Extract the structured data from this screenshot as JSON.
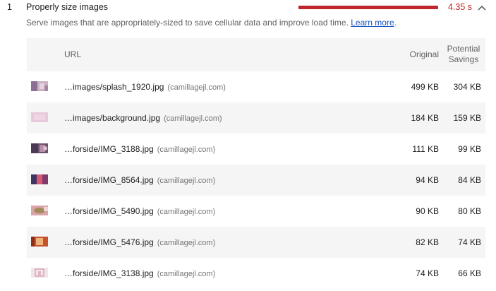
{
  "audit": {
    "index": "1",
    "title": "Properly size images",
    "savings": "4.35 s",
    "description": "Serve images that are appropriately-sized to save cellular data and improve load time.",
    "learn_more": "Learn more",
    "description_end": "."
  },
  "table": {
    "columns": {
      "url": "URL",
      "original": "Original",
      "savings_line1": "Potential",
      "savings_line2": "Savings"
    },
    "rows": [
      {
        "url": "…images/splash_1920.jpg",
        "host": "(camillagejl.com)",
        "original": "499 KB",
        "savings": "304 KB"
      },
      {
        "url": "…images/background.jpg",
        "host": "(camillagejl.com)",
        "original": "184 KB",
        "savings": "159 KB"
      },
      {
        "url": "…forside/IMG_3188.jpg",
        "host": "(camillagejl.com)",
        "original": "111 KB",
        "savings": "99 KB"
      },
      {
        "url": "…forside/IMG_8564.jpg",
        "host": "(camillagejl.com)",
        "original": "94 KB",
        "savings": "84 KB"
      },
      {
        "url": "…forside/IMG_5490.jpg",
        "host": "(camillagejl.com)",
        "original": "90 KB",
        "savings": "80 KB"
      },
      {
        "url": "…forside/IMG_5476.jpg",
        "host": "(camillagejl.com)",
        "original": "82 KB",
        "savings": "74 KB"
      },
      {
        "url": "…forside/IMG_3138.jpg",
        "host": "(camillagejl.com)",
        "original": "74 KB",
        "savings": "66 KB"
      }
    ]
  },
  "colors": {
    "fail": "#c0272d",
    "link": "#1a55c0",
    "row_alt": "#f5f5f5"
  },
  "icons": [
    "chevron-up-icon",
    "thumbnail-image"
  ]
}
